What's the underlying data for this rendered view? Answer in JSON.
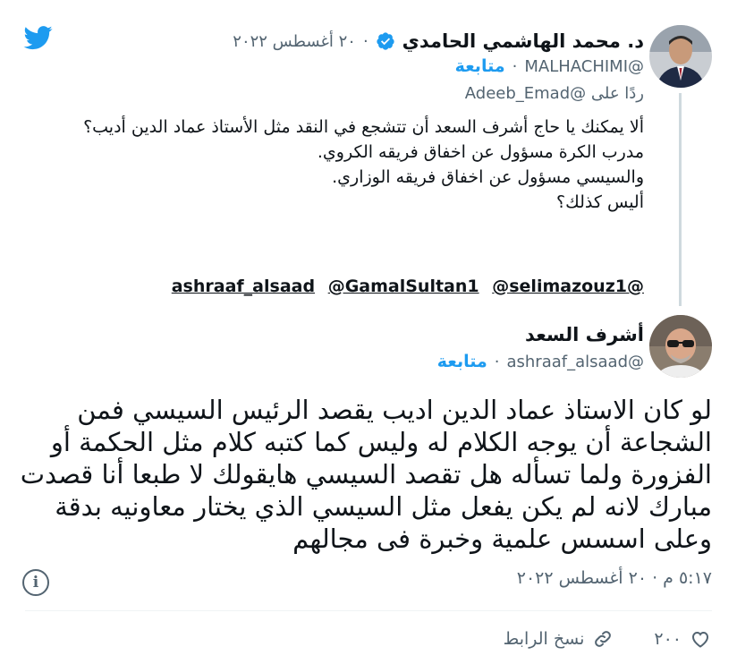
{
  "reply_tweet": {
    "author_name": "د. محمد الهاشمي الحامدي",
    "date": "٢٠ أغسطس ٢٠٢٢",
    "handle": "@MALHACHIMI",
    "follow_label": "متابعة",
    "replying_to": "ردًا على @Adeeb_Emad",
    "body": "ألا يمكنك يا حاج أشرف السعد أن تتشجع في النقد مثل الأستاذ عماد الدين أديب؟\nمدرب الكرة مسؤول عن اخفاق فريقه الكروي.\nوالسيسي مسؤول عن اخفاق فريقه الوزاري.\nأليس كذلك؟",
    "mentions": [
      "@ashraaf_alsaad",
      "@GamalSultan1",
      "@selimazouz1"
    ]
  },
  "main_tweet": {
    "author_name": "أشرف السعد",
    "handle": "@ashraaf_alsaad",
    "follow_label": "متابعة",
    "body": "لو كان الاستاذ عماد الدين اديب يقصد الرئيس السيسي فمن الشجاعة أن يوجه الكلام له وليس كما كتبه كلام مثل الحكمة أو الفزورة ولما تسأله هل تقصد السيسي هايقولك لا طبعا أنا قصدت مبارك لانه لم يكن يفعل مثل السيسي الذي يختار معاونيه بدقة وعلى اسسس علمية وخبرة فى مجالهم",
    "time": "٥:١٧ م · ٢٠ أغسطس ٢٠٢٢",
    "likes": "٢٠٠",
    "copy_link_label": "نسخ الرابط"
  },
  "colors": {
    "accent": "#1d9bf0",
    "secondary_text": "#536471",
    "like_red": "#f91880"
  },
  "icons": [
    "twitter-bird-icon",
    "verified-badge-icon",
    "heart-icon",
    "link-icon",
    "info-icon"
  ]
}
